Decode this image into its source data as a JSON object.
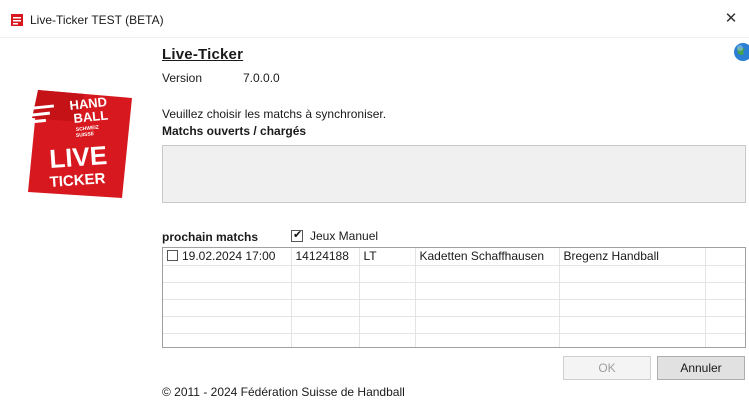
{
  "window": {
    "title": "Live-Ticker TEST (BETA)",
    "close_glyph": "✕"
  },
  "logo": {
    "line1": "HAND",
    "line2": "BALL",
    "small1": "SCHWEIZ",
    "small2": "SUISSE",
    "big1": "LIVE",
    "big2": "TICKER",
    "color": "#d7191f"
  },
  "header": {
    "title": "Live-Ticker",
    "version_label": "Version",
    "version_value": "7.0.0.0"
  },
  "open_matches": {
    "instruction": "Veuillez choisir les matchs à synchroniser.",
    "label": "Matchs ouverts / chargés"
  },
  "upcoming": {
    "label": "prochain matchs",
    "manual_games_label": "Jeux Manuel",
    "manual_games_checked": true,
    "rows": [
      {
        "checked": false,
        "datetime": "19.02.2024 17:00",
        "id": "14124188",
        "code": "LT",
        "home": "Kadetten Schaffhausen",
        "away": "Bregenz Handball"
      }
    ]
  },
  "buttons": {
    "ok_label": "OK",
    "cancel_label": "Annuler"
  },
  "footer": {
    "copyright": "© 2011 - 2024 Fédération Suisse de Handball"
  }
}
